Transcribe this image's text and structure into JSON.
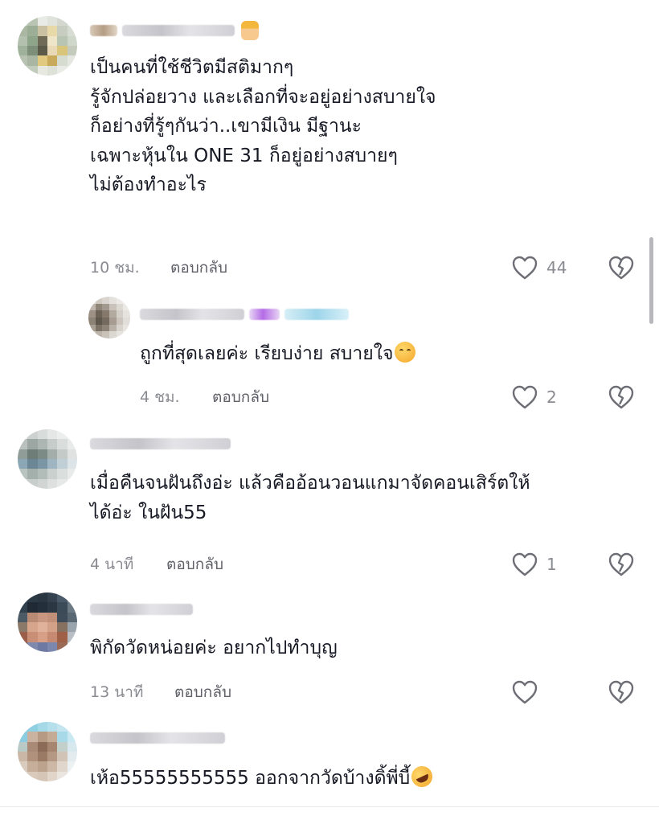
{
  "comments": [
    {
      "lines": [
        "เป็นคนที่ใช้ชีวิตมีสติมากๆ",
        "รู้จักปล่อยวาง และเลือกที่จะอยู่อย่างสบายใจ",
        "ก็อย่างที่รู้ๆกันว่า..เขามีเงิน มีฐานะ",
        "เฉพาะหุ้นใน ONE 31 ก็อยู่อย่างสบายๆ",
        "ไม่ต้องทำอะไร"
      ],
      "time": "10 ชม.",
      "reply_label": "ตอบกลับ",
      "likes": "44",
      "reply": {
        "text": "ถูกที่สุดเลยค่ะ เรียบง่าย สบายใจ",
        "time": "4 ชม.",
        "reply_label": "ตอบกลับ",
        "likes": "2"
      }
    },
    {
      "lines": [
        "เมื่อคืนจนฝันถึงอ่ะ แล้วคืออ้อนวอนแกมาจัดคอนเสิร์ตให้",
        "ได้อ่ะ ในฝัน55"
      ],
      "time": "4 นาที",
      "reply_label": "ตอบกลับ",
      "likes": "1"
    },
    {
      "lines": [
        "พิกัดวัดหน่อยค่ะ อยากไปทำบุญ"
      ],
      "time": "13 นาที",
      "reply_label": "ตอบกลับ",
      "likes": ""
    },
    {
      "lines": [
        "เห้อ55555555555 ออกจากวัดบ้างดิ้พี่บี้"
      ]
    }
  ],
  "icons": {
    "like": "heart-outline-icon",
    "dislike": "broken-heart-icon"
  },
  "colors": {
    "text": "#161823",
    "muted": "#8a8b91",
    "icon": "#6d6e75"
  }
}
